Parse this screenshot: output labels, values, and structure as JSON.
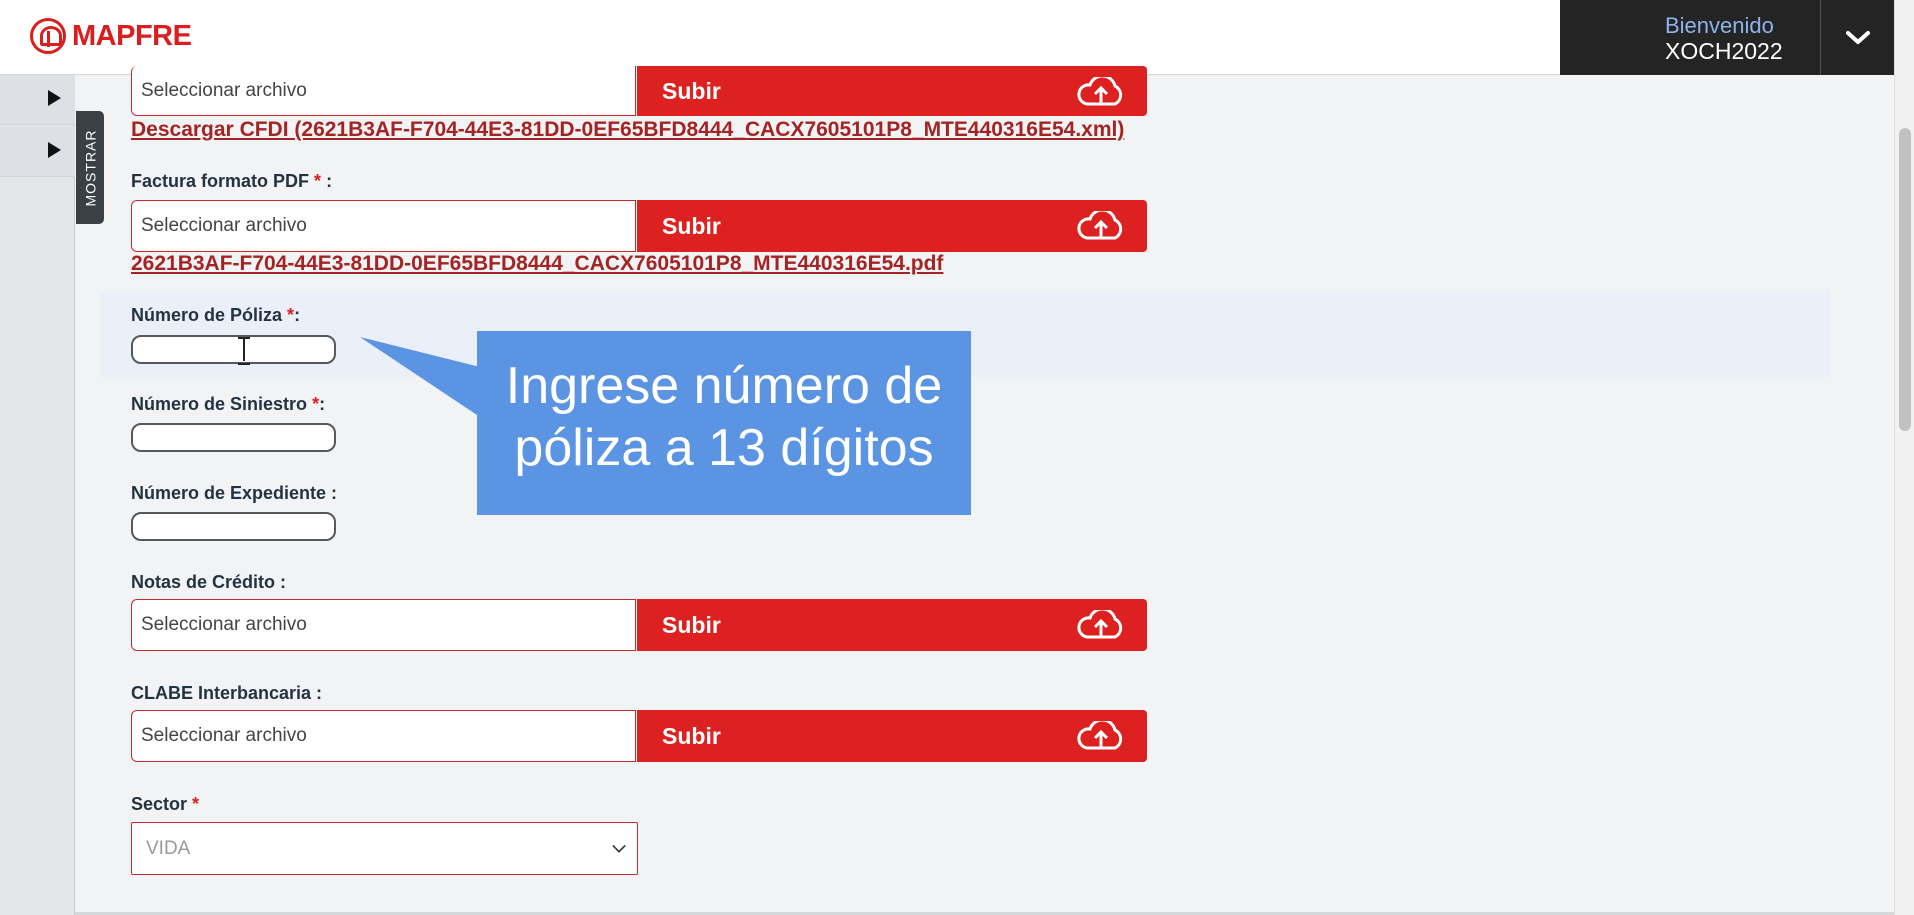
{
  "header": {
    "logo_text": "MAPFRE",
    "welcome_label": "Bienvenido",
    "username": "XOCH2022"
  },
  "sidebar": {
    "toggle_label": "MOSTRAR"
  },
  "form": {
    "top_upload": {
      "placeholder": "Seleccionar archivo",
      "button_label": "Subir",
      "download_link": "Descargar CFDI (2621B3AF-F704-44E3-81DD-0EF65BFD8444_CACX7605101P8_MTE440316E54.xml)"
    },
    "pdf_upload": {
      "label": "Factura formato PDF",
      "required_mark": "*",
      "suffix": " :",
      "placeholder": "Seleccionar archivo",
      "button_label": "Subir",
      "file_link": "2621B3AF-F704-44E3-81DD-0EF65BFD8444_CACX7605101P8_MTE440316E54.pdf"
    },
    "poliza": {
      "label": "Número de Póliza",
      "required_mark": "*",
      "suffix": ":",
      "value": ""
    },
    "siniestro": {
      "label": "Número de Siniestro",
      "required_mark": "*",
      "suffix": ":",
      "value": ""
    },
    "expediente": {
      "label": "Número de Expediente :",
      "value": ""
    },
    "notas_credito": {
      "label": "Notas de Crédito :",
      "placeholder": "Seleccionar archivo",
      "button_label": "Subir"
    },
    "clabe": {
      "label": "CLABE Interbancaria :",
      "placeholder": "Seleccionar archivo",
      "button_label": "Subir"
    },
    "sector": {
      "label": "Sector",
      "required_mark": "*",
      "selected": "VIDA"
    }
  },
  "callout": {
    "line1": "Ingrese número de",
    "line2": "póliza a 13 dígitos"
  },
  "colors": {
    "brand_red": "#dc2120",
    "link_red": "#a42424",
    "callout_blue": "#5b94e2",
    "header_dark": "#242424"
  },
  "icons": {
    "upload": "cloud-upload-icon",
    "user_menu": "chevron-down-icon",
    "side_arrow": "triangle-right-icon",
    "text_cursor": "text-cursor-icon"
  }
}
